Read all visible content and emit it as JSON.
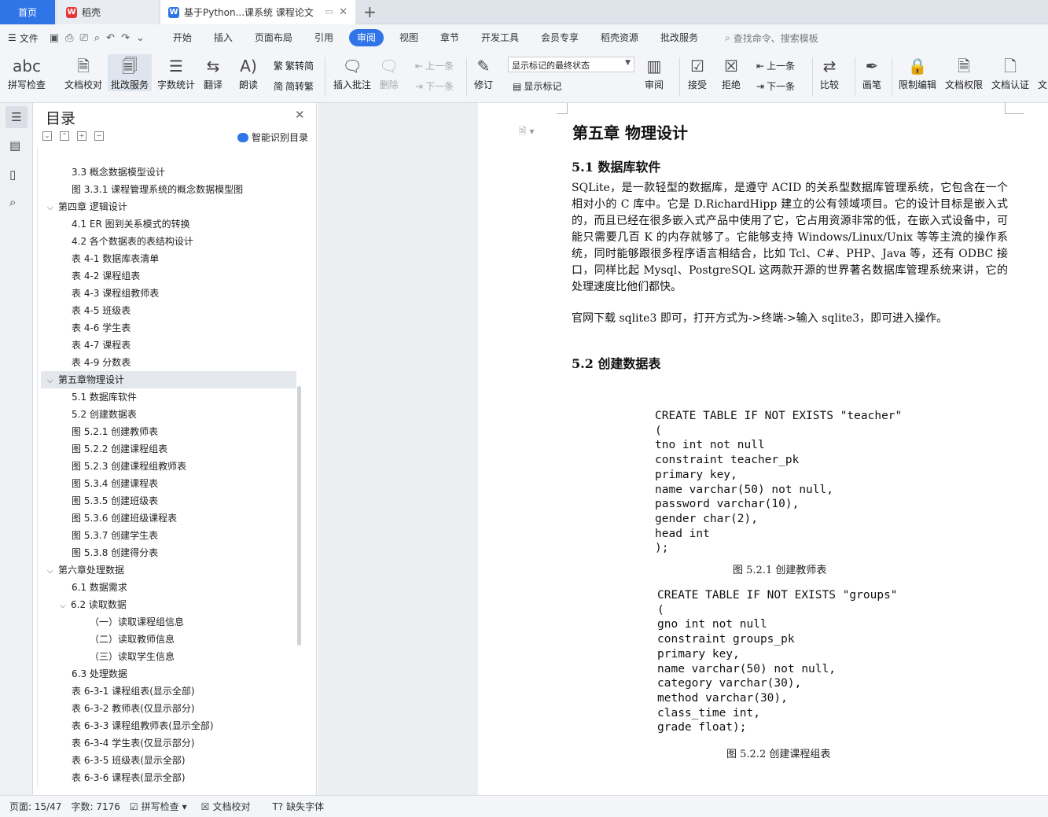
{
  "tabs": {
    "home": "首页",
    "daoke": "稻壳",
    "doc": "基于Python...课系统 课程论文"
  },
  "menu": {
    "file": "文件",
    "items": [
      "开始",
      "插入",
      "页面布局",
      "引用",
      "审阅",
      "视图",
      "章节",
      "开发工具",
      "会员专享",
      "稻壳资源",
      "批改服务"
    ],
    "active": "审阅",
    "search": "查找命令、搜索模板"
  },
  "ribbon": {
    "spell": "拼写检查",
    "proof": "文档校对",
    "review_service": "批改服务",
    "word_count": "字数统计",
    "translate": "翻译",
    "read": "朗读",
    "trad": "繁转简",
    "simp": "简转繁",
    "insert_comment": "插入批注",
    "delete": "删除",
    "prev": "上一条",
    "next": "下一条",
    "track": "修订",
    "markup_state": "显示标记的最终状态",
    "show_markup": "显示标记",
    "review": "审阅",
    "accept": "接受",
    "reject": "拒绝",
    "prev2": "上一条",
    "next2": "下一条",
    "compare": "比较",
    "pen": "画笔",
    "restrict": "限制编辑",
    "perm": "文档权限",
    "cert": "文档认证",
    "more": "文"
  },
  "nav": {
    "title": "目录",
    "smart": "智能识别目录",
    "items": [
      {
        "t": "3.3  概念数据模型设计",
        "lv": 2
      },
      {
        "t": "图 3.3.1  课程管理系统的概念数据模型图",
        "lv": 2
      },
      {
        "t": "第四章  逻辑设计",
        "lv": 1,
        "chev": "⌵"
      },
      {
        "t": "4.1 ER 图到关系模式的转换",
        "lv": 2
      },
      {
        "t": "4.2    各个数据表的表结构设计",
        "lv": 2
      },
      {
        "t": "表 4-1  数据库表清单",
        "lv": 2
      },
      {
        "t": "表 4-2  课程组表",
        "lv": 2
      },
      {
        "t": "表 4-3  课程组教师表",
        "lv": 2
      },
      {
        "t": "表 4-5  班级表",
        "lv": 2
      },
      {
        "t": "表 4-6  学生表",
        "lv": 2
      },
      {
        "t": "表 4-7  课程表",
        "lv": 2
      },
      {
        "t": "表 4-9  分数表",
        "lv": 2
      },
      {
        "t": "第五章物理设计",
        "lv": 1,
        "chev": "⌵",
        "sel": true
      },
      {
        "t": "5.1  数据库软件",
        "lv": 2
      },
      {
        "t": "5.2  创建数据表",
        "lv": 2
      },
      {
        "t": "图 5.2.1  创建教师表",
        "lv": 2
      },
      {
        "t": "图 5.2.2  创建课程组表",
        "lv": 2
      },
      {
        "t": "图 5.2.3  创建课程组教师表",
        "lv": 2
      },
      {
        "t": "图 5.3.4  创建课程表",
        "lv": 2
      },
      {
        "t": "图 5.3.5  创建班级表",
        "lv": 2
      },
      {
        "t": "图 5.3.6  创建班级课程表",
        "lv": 2
      },
      {
        "t": "图 5.3.7  创建学生表",
        "lv": 2
      },
      {
        "t": "图 5.3.8  创建得分表",
        "lv": 2
      },
      {
        "t": "第六章处理数据",
        "lv": 1,
        "chev": "⌵"
      },
      {
        "t": "6.1  数据需求",
        "lv": 2
      },
      {
        "t": "6.2  读取数据",
        "lv": 2,
        "chev": "⌵"
      },
      {
        "t": "（一）读取课程组信息",
        "lv": 3
      },
      {
        "t": "（二）读取教师信息",
        "lv": 3
      },
      {
        "t": "（三）读取学生信息",
        "lv": 3
      },
      {
        "t": "6.3  处理数据",
        "lv": 2
      },
      {
        "t": "表 6-3-1  课程组表(显示全部)",
        "lv": 2
      },
      {
        "t": "表 6-3-2  教师表(仅显示部分)",
        "lv": 2
      },
      {
        "t": "表 6-3-3  课程组教师表(显示全部)",
        "lv": 2
      },
      {
        "t": "表 6-3-4  学生表(仅显示部分)",
        "lv": 2
      },
      {
        "t": "表 6-3-5  班级表(显示全部)",
        "lv": 2
      },
      {
        "t": "表 6-3-6  课程表(显示全部)",
        "lv": 2
      }
    ]
  },
  "doc": {
    "chapter": "第五章  物理设计",
    "h51": "5.1  数据库软件",
    "p1": "SQLite，是一款轻型的数据库，是遵守 ACID 的关系型数据库管理系统，它包含在一个相对小的 C 库中。它是 D.RichardHipp 建立的公有领域项目。它的设计目标是嵌入式的，而且已经在很多嵌入式产品中使用了它，它占用资源非常的低，在嵌入式设备中，可能只需要几百 K 的内存就够了。它能够支持 Windows/Linux/Unix 等等主流的操作系统，同时能够跟很多程序语言相结合，比如 Tcl、C#、PHP、Java 等，还有 ODBC 接口，同样比起 Mysql、PostgreSQL 这两款开源的世界著名数据库管理系统来讲，它的处理速度比他们都快。",
    "p2": "官网下载 sqlite3 即可，打开方式为->终端->输入 sqlite3，即可进入操作。",
    "h52": "5.2  创建数据表",
    "code1": "CREATE TABLE IF NOT EXISTS \"teacher\"\n(\ntno int not null\nconstraint teacher_pk\nprimary key,\nname varchar(50) not null,\npassword varchar(10),\ngender char(2),\nhead int\n);",
    "cap1": "图 5.2.1  创建教师表",
    "code2": "CREATE TABLE IF NOT EXISTS \"groups\"\n(\ngno int not null\nconstraint groups_pk\nprimary key,\nname varchar(50) not null,\ncategory varchar(30),\nmethod varchar(30),\nclass_time int,\ngrade float);",
    "cap2": "图 5.2.2  创建课程组表"
  },
  "status": {
    "page": "页面: 15/47",
    "words": "字数: 7176",
    "spell": "拼写检查",
    "proof": "文档校对",
    "font": "缺失字体"
  }
}
